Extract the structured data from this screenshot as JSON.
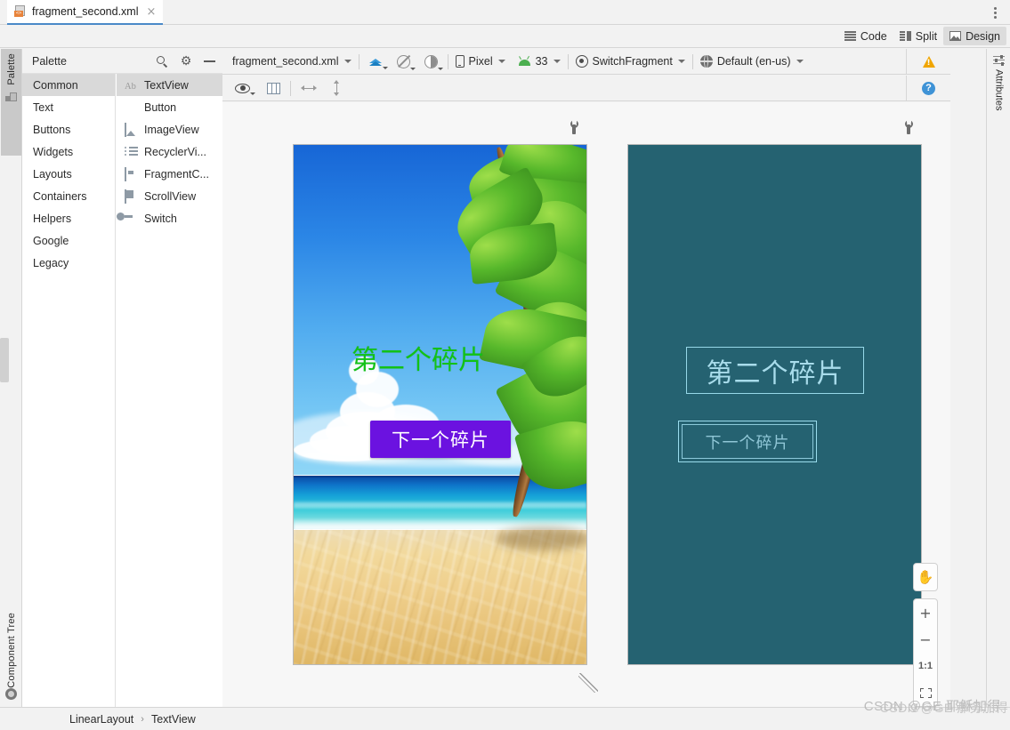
{
  "window": {
    "tab_title": "fragment_second.xml",
    "tab_close": "×"
  },
  "modebar": {
    "code_label": "Code",
    "split_label": "Split",
    "design_label": "Design",
    "active": "Design"
  },
  "palette": {
    "title": "Palette",
    "search_icon": "search-icon",
    "gear_icon": "gear-icon",
    "minimize_icon": "minimize-icon",
    "categories": [
      {
        "label": "Common",
        "selected": true
      },
      {
        "label": "Text",
        "selected": false
      },
      {
        "label": "Buttons",
        "selected": false
      },
      {
        "label": "Widgets",
        "selected": false
      },
      {
        "label": "Layouts",
        "selected": false
      },
      {
        "label": "Containers",
        "selected": false
      },
      {
        "label": "Helpers",
        "selected": false
      },
      {
        "label": "Google",
        "selected": false
      },
      {
        "label": "Legacy",
        "selected": false
      }
    ],
    "items": [
      {
        "label": "TextView",
        "icon": "textview-icon",
        "selected": true
      },
      {
        "label": "Button",
        "icon": "button-icon",
        "selected": false
      },
      {
        "label": "ImageView",
        "icon": "imageview-icon",
        "selected": false
      },
      {
        "label": "RecyclerVi...",
        "icon": "recyclerview-icon",
        "selected": false
      },
      {
        "label": "FragmentC...",
        "icon": "fragmentcontainer-icon",
        "selected": false
      },
      {
        "label": "ScrollView",
        "icon": "scrollview-icon",
        "selected": false
      },
      {
        "label": "Switch",
        "icon": "switch-icon",
        "selected": false
      }
    ]
  },
  "left_tabs": {
    "palette": "Palette",
    "component_tree": "Component Tree"
  },
  "right_tabs": {
    "attributes": "Attributes"
  },
  "design_toolbar": {
    "file_label": "fragment_second.xml",
    "layers_icon": "layers-icon",
    "blueprint_icon": "design-mode-icon",
    "theme_icon": "night-mode-icon",
    "device_label": "Pixel",
    "device_icon": "phone-icon",
    "api_label": "33",
    "api_icon": "android-icon",
    "theme_label": "SwitchFragment",
    "theme_selector_icon": "theme-icon",
    "locale_label": "Default (en-us)",
    "locale_icon": "globe-icon",
    "warning_icon": "warning-icon"
  },
  "design_toolbar2": {
    "eye_icon": "eye-icon",
    "columns_icon": "columns-icon",
    "horizontal_icon": "horizontal-resize-icon",
    "vertical_icon": "vertical-resize-icon",
    "help_icon": "help-icon",
    "help_label": "?"
  },
  "preview": {
    "wrench_icon": "wrench-icon",
    "textview_text": "第二个碎片",
    "button_text": "下一个碎片",
    "textview_color": "#12c216",
    "button_bg_color": "#6b12e0",
    "button_text_color": "#ffffff",
    "blueprint_bg_color": "#256271",
    "blueprint_stroke_color": "#8fd0e0"
  },
  "zoom_controls": {
    "pan_label": "✋",
    "pan_icon": "pan-hand-icon",
    "zoom_in_label": "+",
    "zoom_out_label": "−",
    "actual_size_label": "1:1",
    "fit_icon": "zoom-to-fit-icon"
  },
  "statusbar": {
    "breadcrumb": [
      "LinearLayout",
      "TextView"
    ],
    "separator": "›"
  },
  "watermark": {
    "line1": "CSDN @GE 耶稣加得",
    "line2": "CSDN @GE 那务加得"
  }
}
